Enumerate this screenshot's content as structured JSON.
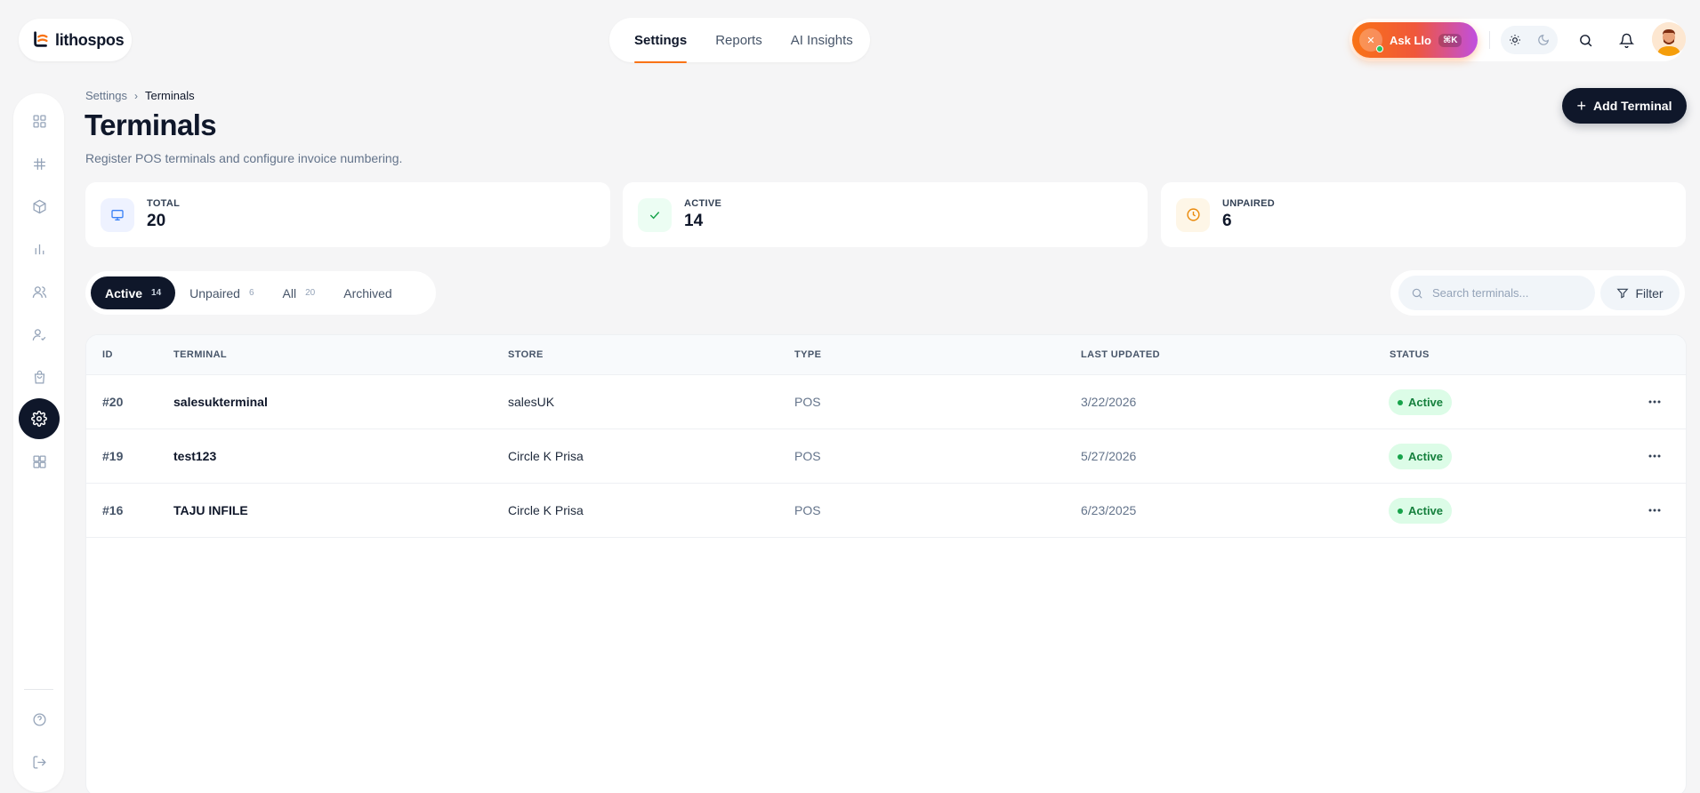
{
  "brand": {
    "name": "lithospos",
    "accent": "#f97316"
  },
  "top_nav": [
    {
      "label": "Settings",
      "active": true
    },
    {
      "label": "Reports",
      "active": false
    },
    {
      "label": "AI Insights",
      "active": false
    }
  ],
  "header_actions": {
    "ask_label": "Ask Llo",
    "ask_shortcut": "⌘K",
    "icons": [
      "sun-icon",
      "moon-icon",
      "search-icon",
      "bell-icon",
      "avatar"
    ]
  },
  "sidebar": {
    "items": [
      "dashboard-icon",
      "grid-icon",
      "box-icon",
      "chart-icon",
      "users-icon",
      "user-check-icon",
      "bag-icon",
      "settings-icon",
      "apps-icon"
    ],
    "active": "settings-icon",
    "bottom": [
      "help-icon",
      "logout-icon"
    ]
  },
  "breadcrumb": {
    "parent": "Settings",
    "separator": "›",
    "current": "Terminals"
  },
  "page": {
    "title": "Terminals",
    "subtitle": "Register POS terminals and configure invoice numbering.",
    "add_button": "Add Terminal"
  },
  "stats": [
    {
      "label": "TOTAL",
      "value": "20",
      "icon": "monitor-icon",
      "color": "#3b82f6"
    },
    {
      "label": "ACTIVE",
      "value": "14",
      "icon": "check-icon",
      "color": "#16a34a"
    },
    {
      "label": "UNPAIRED",
      "value": "6",
      "icon": "clock-icon",
      "color": "#ea8a0c"
    }
  ],
  "tabs": [
    {
      "label": "Active",
      "count": "14",
      "active": true
    },
    {
      "label": "Unpaired",
      "count": "6",
      "active": false
    },
    {
      "label": "All",
      "count": "20",
      "active": false
    },
    {
      "label": "Archived",
      "count": "",
      "active": false
    }
  ],
  "search": {
    "placeholder": "Search terminals...",
    "value": ""
  },
  "filter_label": "Filter",
  "table": {
    "columns": [
      "ID",
      "TERMINAL",
      "STORE",
      "TYPE",
      "LAST UPDATED",
      "STATUS"
    ],
    "rows": [
      {
        "id": "#20",
        "terminal": "salesukterminal",
        "store": "salesUK",
        "type": "POS",
        "updated": "3/22/2026",
        "status": "Active"
      },
      {
        "id": "#19",
        "terminal": "test123",
        "store": "Circle K Prisa",
        "type": "POS",
        "updated": "5/27/2026",
        "status": "Active"
      },
      {
        "id": "#16",
        "terminal": "TAJU INFILE",
        "store": "Circle K Prisa",
        "type": "POS",
        "updated": "6/23/2025",
        "status": "Active"
      }
    ]
  }
}
